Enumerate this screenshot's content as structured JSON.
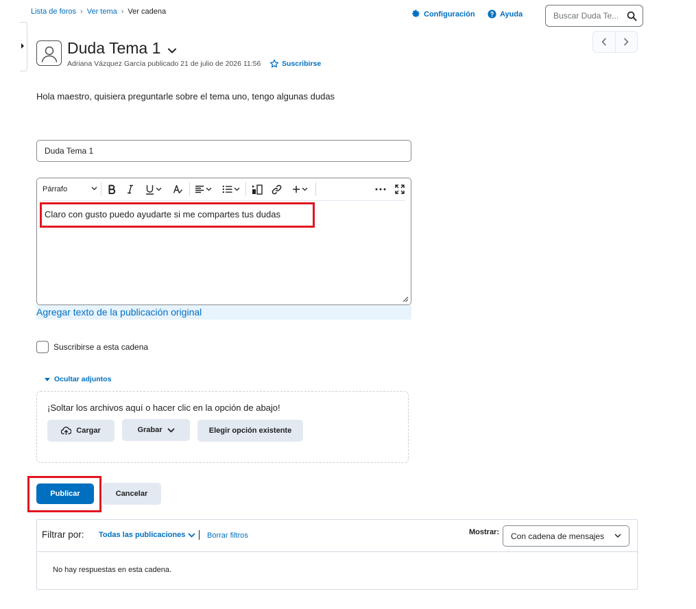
{
  "breadcrumb": {
    "items": [
      "Lista de foros",
      "Ver tema",
      "Ver cadena"
    ],
    "separator": "›"
  },
  "header_links": {
    "settings": "Configuración",
    "help": "Ayuda"
  },
  "search": {
    "placeholder": "Buscar Duda Te..."
  },
  "post": {
    "title": "Duda Tema 1",
    "byline": "Adriana Vázquez García publicado 21 de julio de 2026 11:56",
    "subscribe": "Suscribirse",
    "body": "Hola maestro, quisiera preguntarle sobre el tema uno, tengo algunas dudas"
  },
  "reply": {
    "subject_value": "Duda Tema 1",
    "editor": {
      "format_label": "Párrafo",
      "content": "Claro con gusto puedo ayudarte si me compartes tus dudas"
    },
    "add_original_text": "Agregar texto de la publicación original",
    "subscribe_checkbox_label": "Suscribirse a esta cadena",
    "subscribe_checked": false,
    "attachments": {
      "toggle_label": "Ocultar adjuntos",
      "drop_text": "¡Soltar los archivos aquí o hacer clic en la opción de abajo!",
      "upload": "Cargar",
      "record": "Grabar",
      "existing": "Elegir opción existente"
    },
    "publish": "Publicar",
    "cancel": "Cancelar"
  },
  "filters": {
    "label": "Filtrar por:",
    "value": "Todas las publicaciones",
    "clear": "Borrar filtros",
    "show_label": "Mostrar:",
    "show_value": "Con cadena de mensajes",
    "empty_message": "No hay respuestas en esta cadena."
  },
  "colors": {
    "link": "#006fbf",
    "primary_button": "#006fbf",
    "secondary_button": "#e3e9f1",
    "highlight": "#e0151f",
    "original_text_bg": "#e8f4fd"
  }
}
